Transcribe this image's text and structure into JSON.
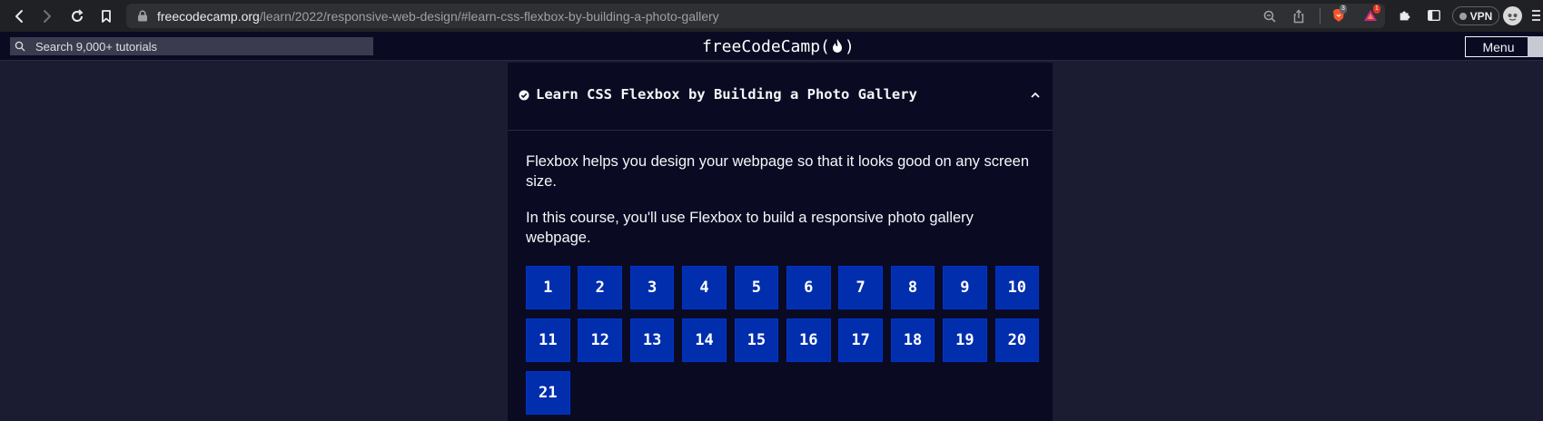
{
  "browser": {
    "url_host": "freecodecamp.org",
    "url_path": "/learn/2022/responsive-web-design/#learn-css-flexbox-by-building-a-photo-gallery",
    "extensions": {
      "brave_shields_count": "3",
      "rewards_count": "1"
    },
    "vpn_label": "VPN"
  },
  "nav": {
    "search_placeholder": "Search 9,000+ tutorials",
    "logo_left": "freeCodeCamp(",
    "logo_right": ")",
    "menu_label": "Menu"
  },
  "course": {
    "title": "Learn CSS Flexbox by Building a Photo Gallery",
    "description_1": "Flexbox helps you design your webpage so that it looks good on any screen size.",
    "description_2": "In this course, you'll use Flexbox to build a responsive photo gallery webpage.",
    "steps": [
      "1",
      "2",
      "3",
      "4",
      "5",
      "6",
      "7",
      "8",
      "9",
      "10",
      "11",
      "12",
      "13",
      "14",
      "15",
      "16",
      "17",
      "18",
      "19",
      "20",
      "21"
    ]
  },
  "colors": {
    "page_bg": "#1b1b32",
    "card_bg": "#0a0a23",
    "step_bg": "#002ead",
    "text": "#f5f6f7"
  }
}
